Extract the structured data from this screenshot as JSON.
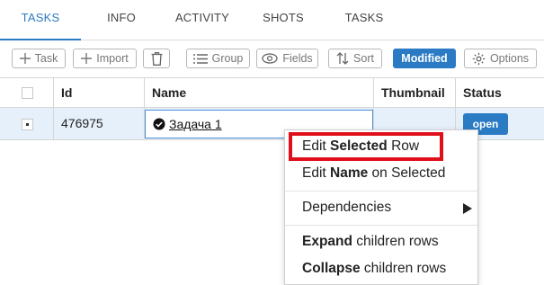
{
  "tabs": [
    "TASKS",
    "INFO",
    "ACTIVITY",
    "SHOTS",
    "TASKS"
  ],
  "toolbar": {
    "task_label": "Task",
    "import_label": "Import",
    "group_label": "Group",
    "fields_label": "Fields",
    "sort_label": "Sort",
    "modified_label": "Modified",
    "options_label": "Options"
  },
  "columns": {
    "id": "Id",
    "name": "Name",
    "thumbnail": "Thumbnail",
    "status": "Status"
  },
  "row": {
    "id": "476975",
    "name": "Задача 1",
    "status": "open"
  },
  "menu": {
    "edit_selected_prefix": "Edit ",
    "edit_selected_bold": "Selected",
    "edit_selected_suffix": " Row",
    "edit_name_prefix": "Edit ",
    "edit_name_bold": "Name",
    "edit_name_suffix": " on Selected",
    "dependencies": "Dependencies",
    "expand_bold": "Expand",
    "expand_suffix": " children rows",
    "collapse_bold": "Collapse",
    "collapse_suffix": " children rows"
  },
  "colors": {
    "accent": "#2b7bc4",
    "highlight": "#e0101a",
    "selected_row": "#e6f0fb"
  }
}
